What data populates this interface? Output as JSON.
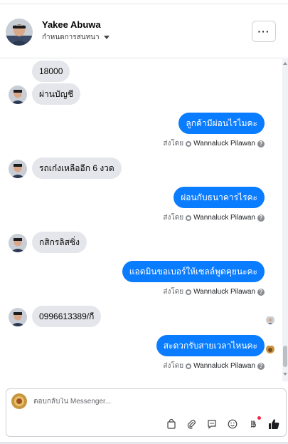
{
  "header": {
    "contact_name": "Yakee Abuwa",
    "assign_label": "กำหนดการสนทนา",
    "more_label": "···"
  },
  "messages": [
    {
      "dir": "in",
      "text": "18000",
      "avatar": false
    },
    {
      "dir": "in",
      "text": "ผ่านบัญชี",
      "avatar": true
    },
    {
      "dir": "out",
      "text": "ลูกค้ามีผ่อนไรไมคะ",
      "sent_by_label": "ส่งโดย",
      "agent": "Wannaluck Pilawan"
    },
    {
      "dir": "in",
      "text": "รถเก๋งเหลืออีก 6 งวด",
      "avatar": true
    },
    {
      "dir": "out",
      "text": "ผ่อนกับธนาคารไรคะ",
      "sent_by_label": "ส่งโดย",
      "agent": "Wannaluck Pilawan"
    },
    {
      "dir": "in",
      "text": "กสิกรลิสซิ่ง",
      "avatar": true
    },
    {
      "dir": "out",
      "text": "แอดมินขอเบอร์ให้เซลล์พูดคุยนะคะ",
      "sent_by_label": "ส่งโดย",
      "agent": "Wannaluck Pilawan"
    },
    {
      "dir": "in",
      "text": "0996613389/กี",
      "avatar": true
    },
    {
      "dir": "out",
      "text": "สะดวกรับสายเวลาไหนคะ",
      "sent_by_label": "ส่งโดย",
      "agent": "Wannaluck Pilawan"
    }
  ],
  "composer": {
    "placeholder": "ตอบกลับใน Messenger..."
  },
  "icons": [
    "shopping-bag-icon",
    "paperclip-icon",
    "chat-bubble-icon",
    "emoji-icon",
    "payment-icon",
    "thumbs-up-icon",
    "gear-icon",
    "info-icon",
    "more-icon"
  ],
  "colors": {
    "outgoing_bubble": "#0a7cff",
    "incoming_bubble": "#e4e6eb",
    "like_icon": "#1c1e21",
    "notification_dot": "#f02849"
  }
}
